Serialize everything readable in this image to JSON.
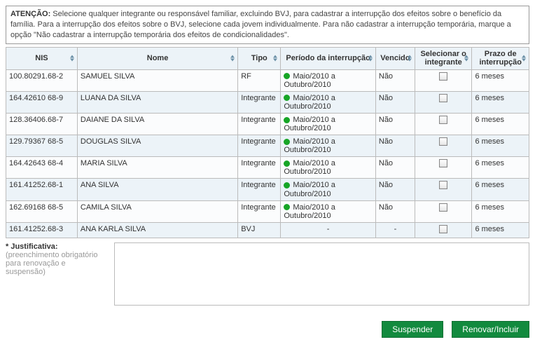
{
  "attention": {
    "label": "ATENÇÃO:",
    "text": "Selecione qualquer integrante ou responsável familiar, excluindo BVJ, para cadastrar a interrupção dos efeitos sobre o benefício da família. Para a interrupção dos efeitos sobre o BVJ, selecione cada jovem individualmente. Para não cadastrar a interrupção temporária, marque a opção \"Não cadastrar a interrupção temporária dos efeitos de condicionalidades\"."
  },
  "headers": {
    "nis": "NIS",
    "nome": "Nome",
    "tipo": "Tipo",
    "periodo": "Período da interrupção",
    "vencido": "Vencido",
    "selecionar": "Selecionar o integrante",
    "prazo": "Prazo de interrupção"
  },
  "rows": [
    {
      "nis": "100.80291.68-2",
      "nome": "SAMUEL SILVA",
      "tipo": "RF",
      "periodo": "Maio/2010 a Outubro/2010",
      "dot": true,
      "vencido": "Não",
      "sel": true,
      "prazo": "6 meses"
    },
    {
      "nis": "164.42610 68-9",
      "nome": "LUANA DA SILVA",
      "tipo": "Integrante",
      "periodo": "Maio/2010 a Outubro/2010",
      "dot": true,
      "vencido": "Não",
      "sel": true,
      "prazo": "6 meses"
    },
    {
      "nis": "128.36406.68-7",
      "nome": "DAIANE DA SILVA",
      "tipo": "Integrante",
      "periodo": "Maio/2010 a Outubro/2010",
      "dot": true,
      "vencido": "Não",
      "sel": true,
      "prazo": "6 meses"
    },
    {
      "nis": "129.79367 68-5",
      "nome": "DOUGLAS SILVA",
      "tipo": "Integrante",
      "periodo": "Maio/2010 a Outubro/2010",
      "dot": true,
      "vencido": "Não",
      "sel": true,
      "prazo": "6 meses"
    },
    {
      "nis": "164.42643 68-4",
      "nome": "MARIA SILVA",
      "tipo": "Integrante",
      "periodo": "Maio/2010 a Outubro/2010",
      "dot": true,
      "vencido": "Não",
      "sel": true,
      "prazo": "6 meses"
    },
    {
      "nis": "161.41252.68-1",
      "nome": "ANA SILVA",
      "tipo": "Integrante",
      "periodo": "Maio/2010 a Outubro/2010",
      "dot": true,
      "vencido": "Não",
      "sel": true,
      "prazo": "6 meses"
    },
    {
      "nis": "162.69168 68-5",
      "nome": "CAMILA SILVA",
      "tipo": "Integrante",
      "periodo": "Maio/2010 a Outubro/2010",
      "dot": true,
      "vencido": "Não",
      "sel": true,
      "prazo": "6 meses"
    },
    {
      "nis": "161.41252.68-3",
      "nome": "ANA KARLA SILVA",
      "tipo": "BVJ",
      "periodo": "-",
      "dot": false,
      "vencido": "-",
      "sel": true,
      "prazo": "6 meses"
    }
  ],
  "justificativa": {
    "label": "* Justificativa:",
    "hint": "(preenchimento obrigatório para renovação e suspensão)"
  },
  "buttons": {
    "suspender": "Suspender",
    "renovar": "Renovar/Incluir"
  },
  "colors": {
    "primary": "#128a3e",
    "status_dot": "#17a526"
  }
}
